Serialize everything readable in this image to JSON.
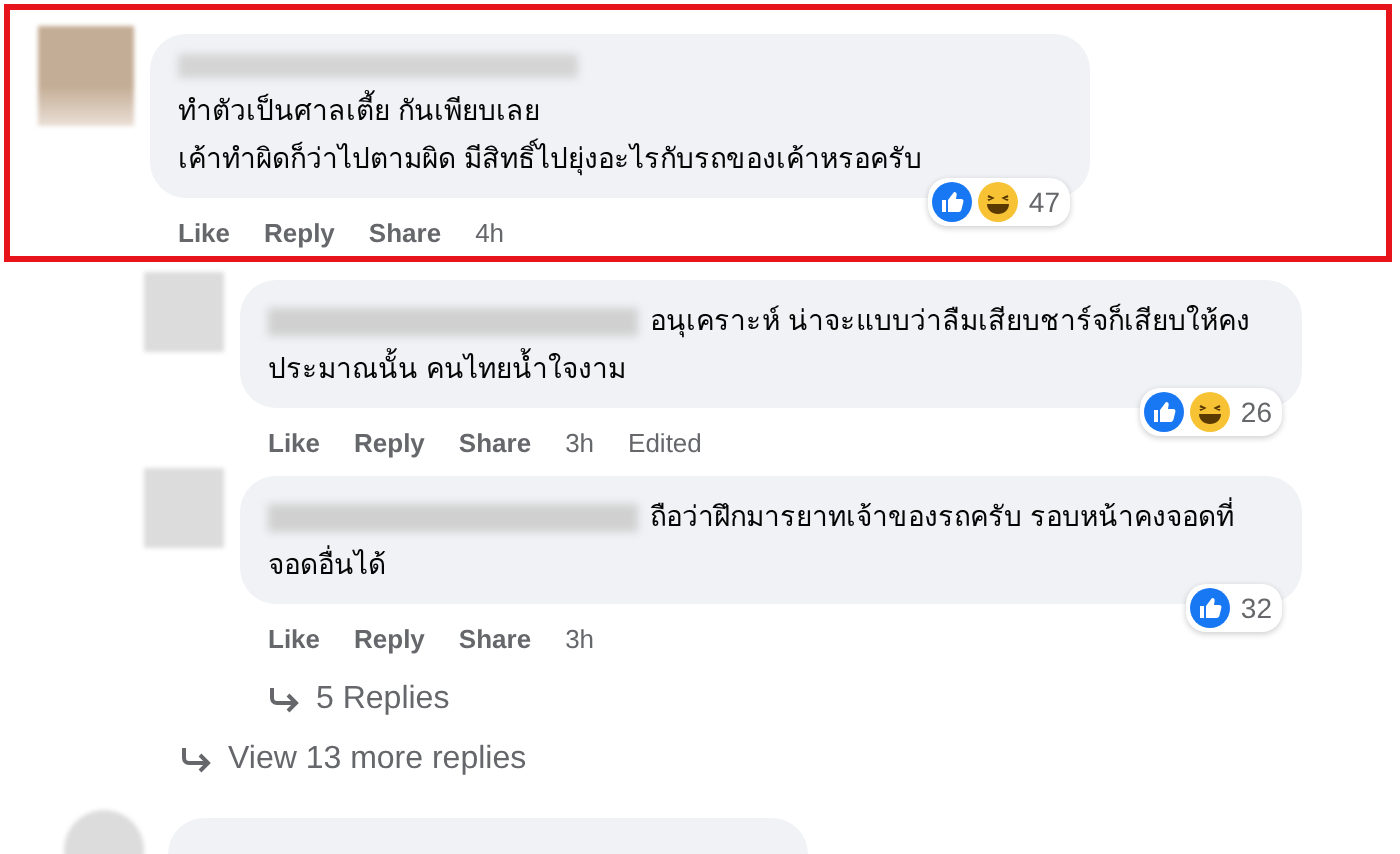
{
  "comments": [
    {
      "highlighted": true,
      "text": "ทำตัวเป็นศาลเตี้ย กันเพียบเลย\nเค้าทำผิดก็ว่าไปตามผิด มีสิทธิ์ไปยุ่งอะไรกับรถของเค้าหรอครับ",
      "actions": [
        "Like",
        "Reply",
        "Share"
      ],
      "time": "4h",
      "reactions": [
        {
          "kind": "like"
        },
        {
          "kind": "haha"
        }
      ],
      "reaction_count": "47"
    },
    {
      "highlighted": false,
      "text": "อนุเคราะห์ น่าจะแบบว่าลืมเสียบชาร์จก็เสียบให้คงประมาณนั้น คนไทยน้ำใจงาม",
      "actions": [
        "Like",
        "Reply",
        "Share"
      ],
      "time": "3h",
      "edited": "Edited",
      "reactions": [
        {
          "kind": "like"
        },
        {
          "kind": "haha"
        }
      ],
      "reaction_count": "26"
    },
    {
      "highlighted": false,
      "text": "ถือว่าฝึกมารยาทเจ้าของรถครับ รอบหน้าคงจอดที่จอดอื่นได้",
      "actions": [
        "Like",
        "Reply",
        "Share"
      ],
      "time": "3h",
      "reactions": [
        {
          "kind": "like"
        }
      ],
      "reaction_count": "32",
      "replies_link": "5 Replies"
    }
  ],
  "more_replies": "View 13 more replies"
}
